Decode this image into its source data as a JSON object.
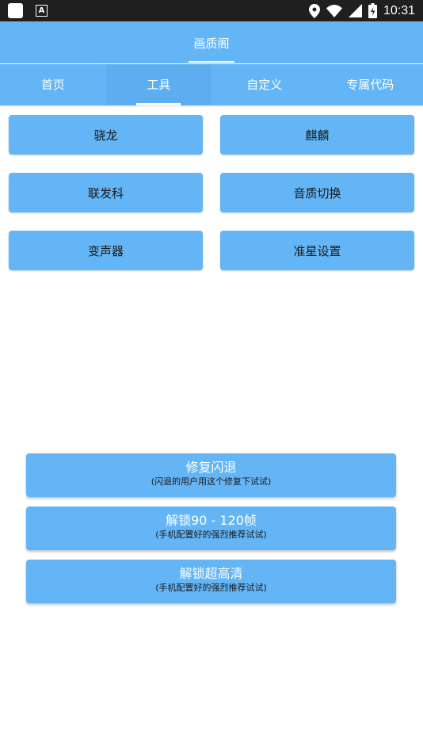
{
  "status_bar": {
    "time": "10:31",
    "icons": [
      "app-square-icon",
      "font-a-icon",
      "location-icon",
      "wifi-icon",
      "signal-icon",
      "battery-icon"
    ]
  },
  "app": {
    "title": "画质阁"
  },
  "tabs": [
    {
      "label": "首页",
      "active": false
    },
    {
      "label": "工具",
      "active": true
    },
    {
      "label": "自定义",
      "active": false
    },
    {
      "label": "专属代码",
      "active": false
    }
  ],
  "tools": {
    "snapdragon": "骁龙",
    "kirin": "麒麟",
    "mediatek": "联发科",
    "audio_switch": "音质切换",
    "voice_changer": "变声器",
    "crosshair_settings": "准星设置"
  },
  "actions": {
    "fix_crash": {
      "title": "修复闪退",
      "subtitle": "(闪退的用户用这个修复下试试)"
    },
    "unlock_fps": {
      "title": "解锁90 - 120帧",
      "subtitle": "(手机配置好的强烈推荐试试)"
    },
    "unlock_hd": {
      "title": "解锁超高清",
      "subtitle": "(手机配置好的强烈推荐试试)"
    }
  },
  "colors": {
    "primary": "#63b5f6",
    "status_bar": "#1f1f1f",
    "text_dark": "#1a1a1a",
    "text_light": "#ffffff"
  }
}
